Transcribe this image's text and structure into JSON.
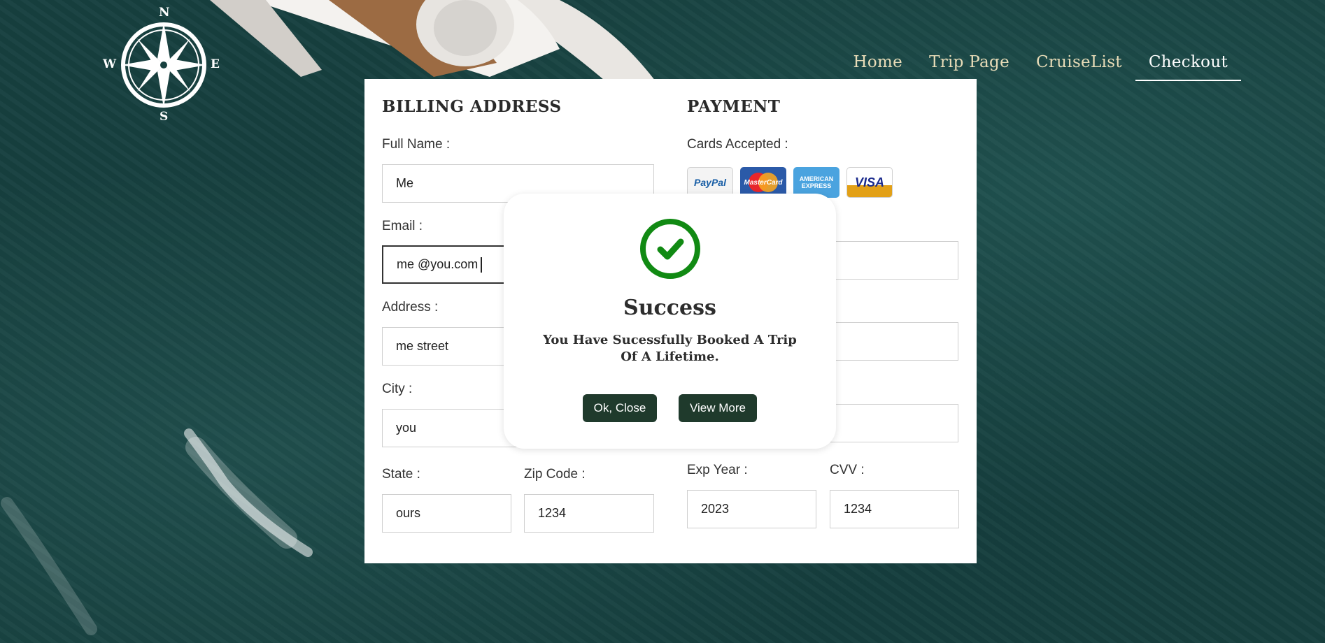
{
  "nav": {
    "items": [
      {
        "label": "Home",
        "active": false
      },
      {
        "label": "Trip Page",
        "active": false
      },
      {
        "label": "CruiseList",
        "active": false
      },
      {
        "label": "Checkout",
        "active": true
      }
    ]
  },
  "logo": {
    "north": "N",
    "south": "S",
    "east": "E",
    "west": "W",
    "icon": "compass-rose-icon"
  },
  "billing": {
    "title": "BILLING ADDRESS",
    "full_name_label": "Full Name :",
    "full_name_value": "Me",
    "email_label": "Email :",
    "email_value": "me @you.com",
    "address_label": "Address :",
    "address_value": "me street",
    "city_label": "City :",
    "city_value": "you",
    "state_label": "State :",
    "state_value": "ours",
    "zip_label": "Zip Code :",
    "zip_value": "1234"
  },
  "payment": {
    "title": "PAYMENT",
    "cards_label": "Cards Accepted :",
    "cards": [
      "PayPal",
      "MasterCard",
      "AMERICAN EXPRESS",
      "VISA"
    ],
    "exp_year_label": "Exp Year :",
    "exp_year_value": "2023",
    "cvv_label": "CVV :",
    "cvv_value": "1234"
  },
  "modal": {
    "icon": "check-circle-icon",
    "title": "Success",
    "message": "You Have Sucessfully Booked A Trip Of A Lifetime.",
    "ok_label": "Ok, Close",
    "view_label": "View More"
  },
  "colors": {
    "nav_text": "#e8dcb8",
    "success_green": "#118a13",
    "button_bg": "#1f3a2c",
    "ocean": "#17403f"
  }
}
